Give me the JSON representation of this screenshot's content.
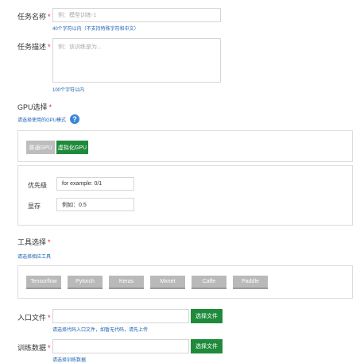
{
  "task_name": {
    "label": "任务名称",
    "required_mark": "*",
    "placeholder": "例：模型训练-1",
    "hint": "40个字符以内（不支持特殊字符和中文）"
  },
  "task_desc": {
    "label": "任务描述",
    "required_mark": "*",
    "placeholder": "例：该训练是为...",
    "hint": "100个字符以内"
  },
  "gpu": {
    "label": "GPU选择",
    "required_mark": "*",
    "hint": "请选择使用的GPU模式",
    "help_icon": "question-icon",
    "buttons": [
      "普通GPU",
      "虚拟化GPU"
    ],
    "selected": "虚拟化GPU",
    "priority_label": "优先级",
    "priority_value": "for example: 0/1",
    "memory_label": "显存",
    "memory_value": "例如：0.5"
  },
  "tools": {
    "label": "工具选择",
    "required_mark": "*",
    "hint": "请选择相应工具",
    "items": [
      "Tensorflow",
      "Pytorch",
      "Keras",
      "Mxnet",
      "Caffe",
      "Paddle"
    ]
  },
  "entry_file": {
    "label": "入口文件",
    "required_mark": "*",
    "button": "选择文件",
    "hint": "请选择代码入口文件，如暂无代码，请先上传"
  },
  "train_data": {
    "label": "训练数据",
    "required_mark": "*",
    "button": "选择文件",
    "hint": "请选择训练数据"
  },
  "colors": {
    "accent_green": "#1f8b3a",
    "link_blue": "#1a5fb4",
    "required_red": "#e02020"
  }
}
